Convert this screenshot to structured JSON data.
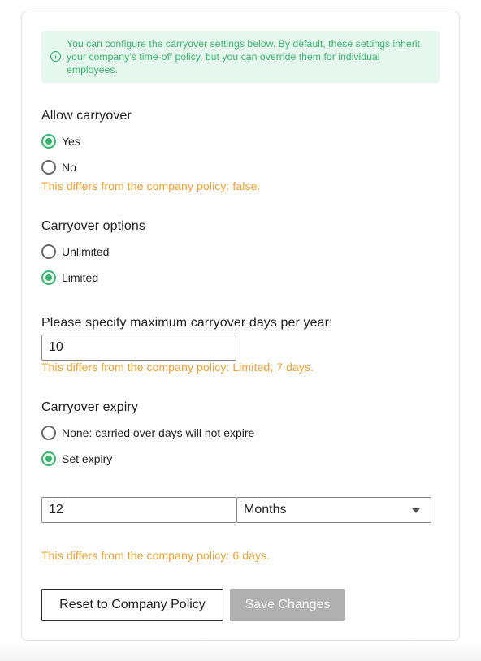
{
  "notice": {
    "icon": "info-icon",
    "text": "You can configure the carryover settings below. By default, these settings inherit your company’s time-off policy, but you can override them for individual employees."
  },
  "allow_carryover": {
    "title": "Allow carryover",
    "options": [
      {
        "label": "Yes",
        "checked": true
      },
      {
        "label": "No",
        "checked": false
      }
    ],
    "warning": "This differs from the company policy: false."
  },
  "carryover_options": {
    "title": "Carryover options",
    "options": [
      {
        "label": "Unlimited",
        "checked": false
      },
      {
        "label": "Limited",
        "checked": true
      }
    ]
  },
  "max_days": {
    "label": "Please specify maximum carryover days per year:",
    "value": "10",
    "warning": "This differs from the company policy: Limited, 7 days."
  },
  "expiry": {
    "title": "Carryover expiry",
    "options": [
      {
        "label": "None: carried over days will not expire",
        "checked": false
      },
      {
        "label": "Set expiry",
        "checked": true
      }
    ],
    "amount": "12",
    "unit": "Months",
    "warning": "This differs from the company policy: 6 days."
  },
  "actions": {
    "reset_label": "Reset to Company Policy",
    "save_label": "Save Changes"
  },
  "colors": {
    "accent": "#3cb36f",
    "notice_bg": "#e6f8ee",
    "warning": "#f0a030",
    "disabled": "#b0b0b0"
  }
}
